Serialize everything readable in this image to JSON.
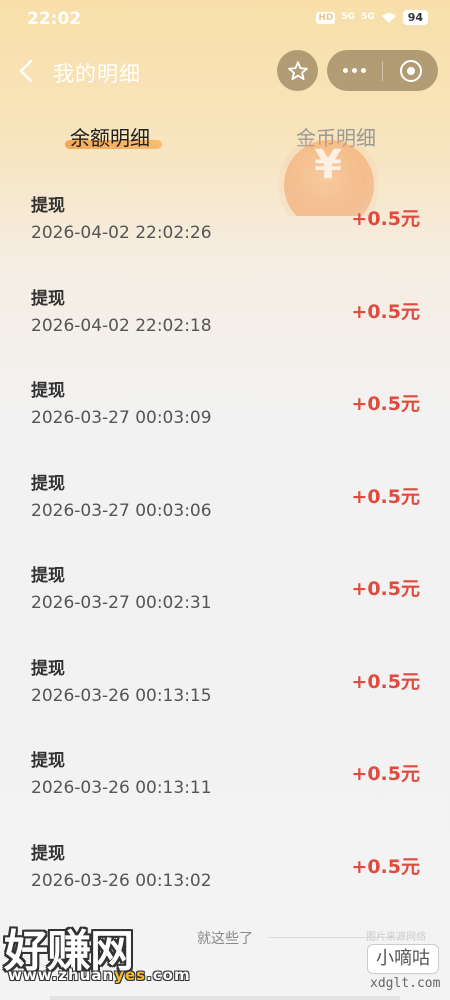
{
  "status_bar": {
    "time": "22:02",
    "hd_badge": "HD",
    "signal1": "5G",
    "signal2": "5G",
    "battery": "94"
  },
  "nav": {
    "title": "我的明细"
  },
  "tabs": [
    {
      "label": "余额明细",
      "active": true
    },
    {
      "label": "金币明细",
      "active": false
    }
  ],
  "deco": {
    "coin_symbol": "¥"
  },
  "records": [
    {
      "type": "提现",
      "time": "2026-04-02 22:02:26",
      "amount": "+0.5元"
    },
    {
      "type": "提现",
      "time": "2026-04-02 22:02:18",
      "amount": "+0.5元"
    },
    {
      "type": "提现",
      "time": "2026-03-27 00:03:09",
      "amount": "+0.5元"
    },
    {
      "type": "提现",
      "time": "2026-03-27 00:03:06",
      "amount": "+0.5元"
    },
    {
      "type": "提现",
      "time": "2026-03-27 00:02:31",
      "amount": "+0.5元"
    },
    {
      "type": "提现",
      "time": "2026-03-26 00:13:15",
      "amount": "+0.5元"
    },
    {
      "type": "提现",
      "time": "2026-03-26 00:13:11",
      "amount": "+0.5元"
    },
    {
      "type": "提现",
      "time": "2026-03-26 00:13:02",
      "amount": "+0.5元"
    }
  ],
  "end_text": "就这些了",
  "watermark": {
    "main": "好赚网",
    "url_a": "www.zhuan",
    "url_b": "yes",
    "url_c": ".com",
    "small_right": "图片来源网络",
    "badge": "小嘀咕",
    "domain": "xdglt.com"
  },
  "colors": {
    "amount": "#e04a3f",
    "tab_underline": "#f4a14a",
    "header_bg": "#f8dfaa"
  }
}
